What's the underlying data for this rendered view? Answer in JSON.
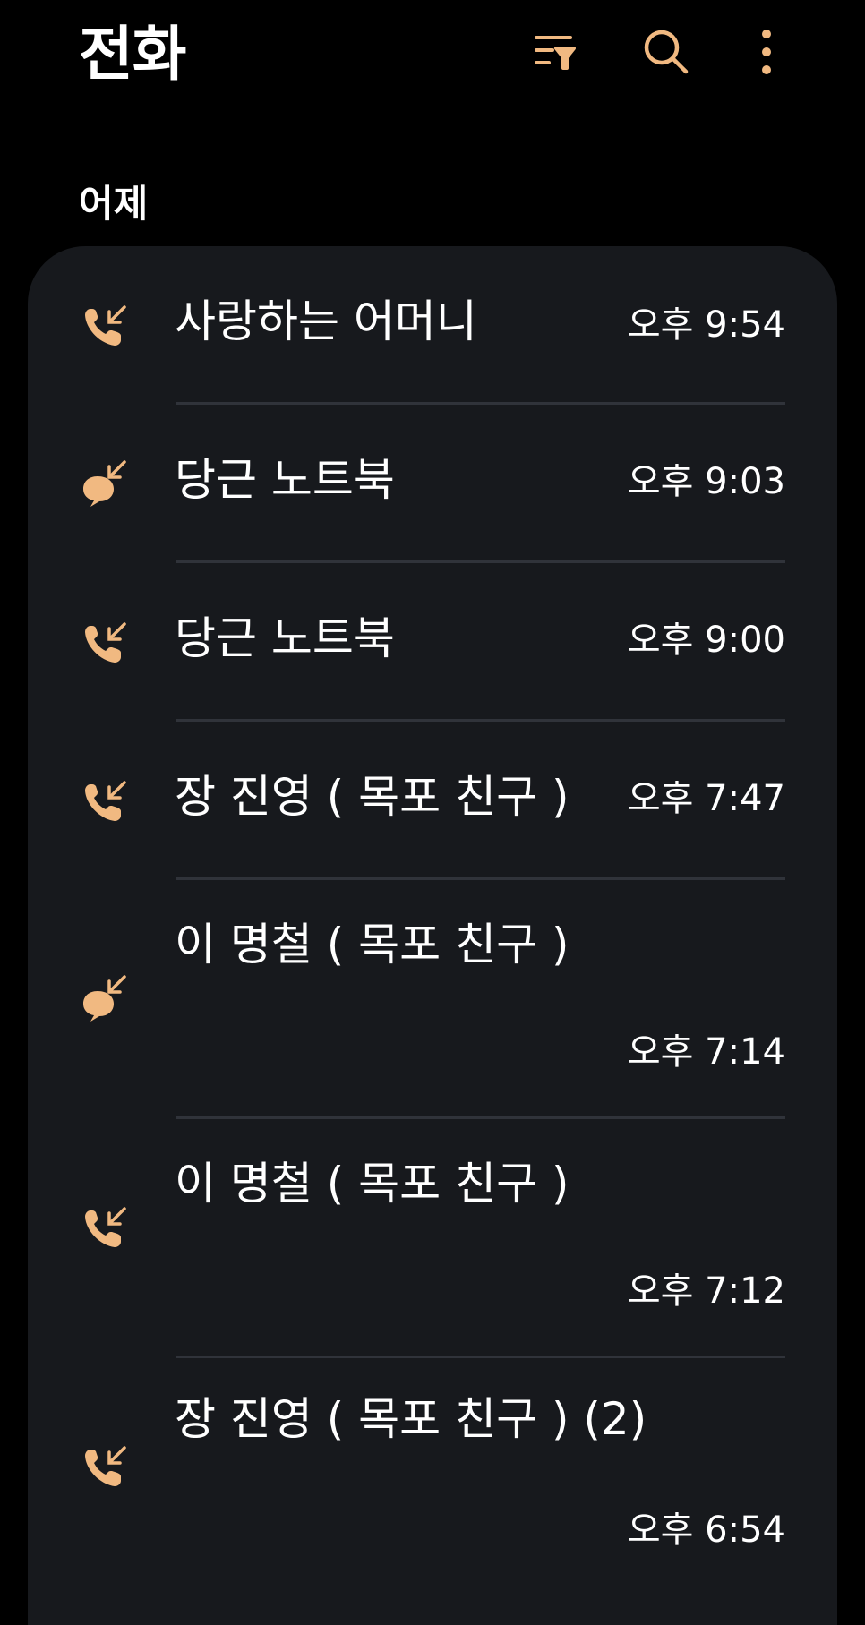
{
  "header": {
    "title": "전화"
  },
  "section_label": "어제",
  "colors": {
    "accent": "#f1b981",
    "background": "#000000",
    "card": "#17191d"
  },
  "calls": [
    {
      "name": "사랑하는 어머니",
      "time": "오후 9:54",
      "icon": "incoming-call-icon"
    },
    {
      "name": "당근 노트북",
      "time": "오후 9:03",
      "icon": "incoming-chat-call-icon"
    },
    {
      "name": "당근 노트북",
      "time": "오후 9:00",
      "icon": "incoming-call-icon"
    },
    {
      "name": "장 진영 ( 목포 친구 )",
      "time": "오후 7:47",
      "icon": "incoming-call-icon"
    },
    {
      "name": "이 명철 (  목포 친구 )",
      "time": "오후 7:14",
      "icon": "incoming-chat-call-icon"
    },
    {
      "name": "이 명철 (  목포 친구 )",
      "time": "오후 7:12",
      "icon": "incoming-call-icon"
    },
    {
      "name": "장 진영 ( 목포 친구 ) (2)",
      "time": "오후 6:54",
      "icon": "incoming-call-icon"
    }
  ]
}
